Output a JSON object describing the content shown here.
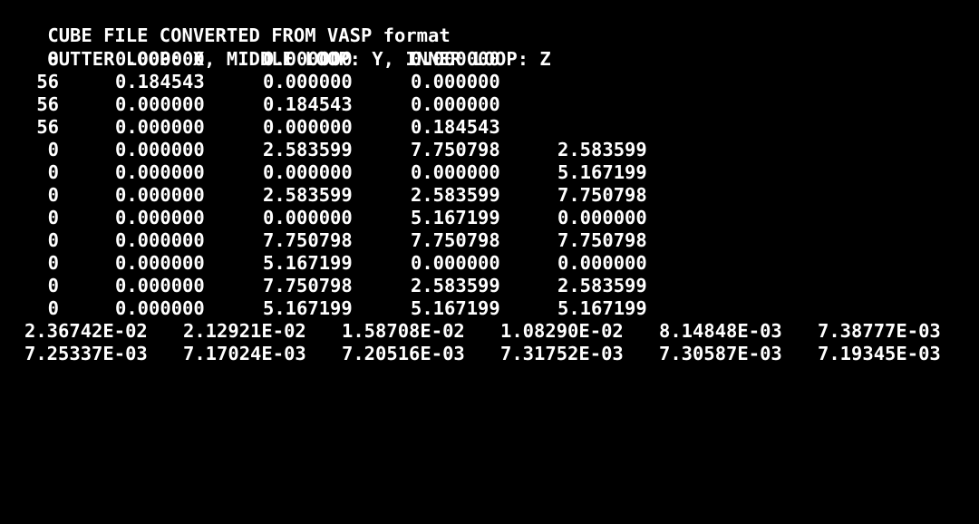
{
  "header": {
    "title": "CUBE FILE CONVERTED FROM VASP format",
    "loop_order": "OUTTER LOOP: X, MIDDLE LOOP: Y, INNER LOOP: Z"
  },
  "grid": {
    "origin": {
      "count": "8",
      "x": "0.000000",
      "y": "0.000000",
      "z": "0.000000"
    },
    "axes": [
      {
        "count": "56",
        "x": "0.184543",
        "y": "0.000000",
        "z": "0.000000"
      },
      {
        "count": "56",
        "x": "0.000000",
        "y": "0.184543",
        "z": "0.000000"
      },
      {
        "count": "56",
        "x": "0.000000",
        "y": "0.000000",
        "z": "0.184543"
      }
    ]
  },
  "atoms": [
    {
      "number": "0",
      "charge": "0.000000",
      "x": "2.583599",
      "y": "7.750798",
      "z": "2.583599"
    },
    {
      "number": "0",
      "charge": "0.000000",
      "x": "0.000000",
      "y": "0.000000",
      "z": "5.167199"
    },
    {
      "number": "0",
      "charge": "0.000000",
      "x": "2.583599",
      "y": "2.583599",
      "z": "7.750798"
    },
    {
      "number": "0",
      "charge": "0.000000",
      "x": "0.000000",
      "y": "5.167199",
      "z": "0.000000"
    },
    {
      "number": "0",
      "charge": "0.000000",
      "x": "7.750798",
      "y": "7.750798",
      "z": "7.750798"
    },
    {
      "number": "0",
      "charge": "0.000000",
      "x": "5.167199",
      "y": "0.000000",
      "z": "0.000000"
    },
    {
      "number": "0",
      "charge": "0.000000",
      "x": "7.750798",
      "y": "2.583599",
      "z": "2.583599"
    },
    {
      "number": "0",
      "charge": "0.000000",
      "x": "5.167199",
      "y": "5.167199",
      "z": "5.167199"
    }
  ],
  "volumetric_data": [
    [
      "2.36742E-02",
      "2.12921E-02",
      "1.58708E-02",
      "1.08290E-02",
      "8.14848E-03",
      "7.38777E-03"
    ],
    [
      "7.25337E-03",
      "7.17024E-03",
      "7.20516E-03",
      "7.31752E-03",
      "7.30587E-03",
      "7.19345E-03"
    ]
  ]
}
